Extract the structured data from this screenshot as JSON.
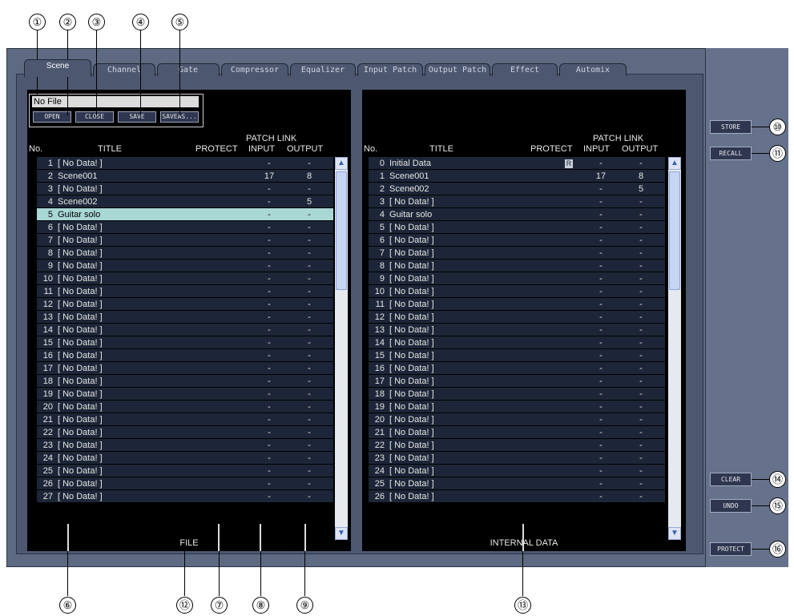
{
  "tabs": [
    "Scene",
    "Channel",
    "Gate",
    "Compressor",
    "Equalizer",
    "Input Patch",
    "Output Patch",
    "Effect",
    "Automix"
  ],
  "file": {
    "name": "No File",
    "buttons": {
      "open": "OPEN",
      "close": "CLOSE",
      "save": "SAVE",
      "saveas": "SAVEAS..."
    }
  },
  "columns": {
    "no": "No.",
    "title": "TITLE",
    "protect": "PROTECT",
    "patch_link": "PATCH LINK",
    "input": "INPUT",
    "output": "OUTPUT"
  },
  "left_panel": {
    "footer": "FILE",
    "rows": [
      {
        "no": "1",
        "title": "[  No Data!  ]",
        "protect": "",
        "input": "-",
        "output": "-"
      },
      {
        "no": "2",
        "title": "Scene001",
        "protect": "",
        "input": "17",
        "output": "8"
      },
      {
        "no": "3",
        "title": "[  No Data!  ]",
        "protect": "",
        "input": "-",
        "output": "-"
      },
      {
        "no": "4",
        "title": "Scene002",
        "protect": "",
        "input": "-",
        "output": "5"
      },
      {
        "no": "5",
        "title": "Guitar solo",
        "protect": "",
        "input": "-",
        "output": "-",
        "selected": true
      },
      {
        "no": "6",
        "title": "[  No Data!  ]",
        "protect": "",
        "input": "-",
        "output": "-"
      },
      {
        "no": "7",
        "title": "[  No Data!  ]",
        "protect": "",
        "input": "-",
        "output": "-"
      },
      {
        "no": "8",
        "title": "[  No Data!  ]",
        "protect": "",
        "input": "-",
        "output": "-"
      },
      {
        "no": "9",
        "title": "[  No Data!  ]",
        "protect": "",
        "input": "-",
        "output": "-"
      },
      {
        "no": "10",
        "title": "[  No Data!  ]",
        "protect": "",
        "input": "-",
        "output": "-"
      },
      {
        "no": "11",
        "title": "[  No Data!  ]",
        "protect": "",
        "input": "-",
        "output": "-"
      },
      {
        "no": "12",
        "title": "[  No Data!  ]",
        "protect": "",
        "input": "-",
        "output": "-"
      },
      {
        "no": "13",
        "title": "[  No Data!  ]",
        "protect": "",
        "input": "-",
        "output": "-"
      },
      {
        "no": "14",
        "title": "[  No Data!  ]",
        "protect": "",
        "input": "-",
        "output": "-"
      },
      {
        "no": "15",
        "title": "[  No Data!  ]",
        "protect": "",
        "input": "-",
        "output": "-"
      },
      {
        "no": "16",
        "title": "[  No Data!  ]",
        "protect": "",
        "input": "-",
        "output": "-"
      },
      {
        "no": "17",
        "title": "[  No Data!  ]",
        "protect": "",
        "input": "-",
        "output": "-"
      },
      {
        "no": "18",
        "title": "[  No Data!  ]",
        "protect": "",
        "input": "-",
        "output": "-"
      },
      {
        "no": "19",
        "title": "[  No Data!  ]",
        "protect": "",
        "input": "-",
        "output": "-"
      },
      {
        "no": "20",
        "title": "[  No Data!  ]",
        "protect": "",
        "input": "-",
        "output": "-"
      },
      {
        "no": "21",
        "title": "[  No Data!  ]",
        "protect": "",
        "input": "-",
        "output": "-"
      },
      {
        "no": "22",
        "title": "[  No Data!  ]",
        "protect": "",
        "input": "-",
        "output": "-"
      },
      {
        "no": "23",
        "title": "[  No Data!  ]",
        "protect": "",
        "input": "-",
        "output": "-"
      },
      {
        "no": "24",
        "title": "[  No Data!  ]",
        "protect": "",
        "input": "-",
        "output": "-"
      },
      {
        "no": "25",
        "title": "[  No Data!  ]",
        "protect": "",
        "input": "-",
        "output": "-"
      },
      {
        "no": "26",
        "title": "[  No Data!  ]",
        "protect": "",
        "input": "-",
        "output": "-"
      },
      {
        "no": "27",
        "title": "[  No Data!  ]",
        "protect": "",
        "input": "-",
        "output": "-"
      }
    ]
  },
  "right_panel": {
    "footer": "INTERNAL DATA",
    "rows": [
      {
        "no": "0",
        "title": "Initial Data",
        "protect": "R",
        "input": "-",
        "output": "-"
      },
      {
        "no": "1",
        "title": "Scene001",
        "protect": "",
        "input": "17",
        "output": "8"
      },
      {
        "no": "2",
        "title": "Scene002",
        "protect": "",
        "input": "-",
        "output": "5"
      },
      {
        "no": "3",
        "title": "[  No Data!  ]",
        "protect": "",
        "input": "-",
        "output": "-"
      },
      {
        "no": "4",
        "title": "Guitar solo",
        "protect": "",
        "input": "-",
        "output": "-"
      },
      {
        "no": "5",
        "title": "[  No Data!  ]",
        "protect": "",
        "input": "-",
        "output": "-"
      },
      {
        "no": "6",
        "title": "[  No Data!  ]",
        "protect": "",
        "input": "-",
        "output": "-"
      },
      {
        "no": "7",
        "title": "[  No Data!  ]",
        "protect": "",
        "input": "-",
        "output": "-"
      },
      {
        "no": "8",
        "title": "[  No Data!  ]",
        "protect": "",
        "input": "-",
        "output": "-"
      },
      {
        "no": "9",
        "title": "[  No Data!  ]",
        "protect": "",
        "input": "-",
        "output": "-"
      },
      {
        "no": "10",
        "title": "[  No Data!  ]",
        "protect": "",
        "input": "-",
        "output": "-"
      },
      {
        "no": "11",
        "title": "[  No Data!  ]",
        "protect": "",
        "input": "-",
        "output": "-"
      },
      {
        "no": "12",
        "title": "[  No Data!  ]",
        "protect": "",
        "input": "-",
        "output": "-"
      },
      {
        "no": "13",
        "title": "[  No Data!  ]",
        "protect": "",
        "input": "-",
        "output": "-"
      },
      {
        "no": "14",
        "title": "[  No Data!  ]",
        "protect": "",
        "input": "-",
        "output": "-"
      },
      {
        "no": "15",
        "title": "[  No Data!  ]",
        "protect": "",
        "input": "-",
        "output": "-"
      },
      {
        "no": "16",
        "title": "[  No Data!  ]",
        "protect": "",
        "input": "-",
        "output": "-"
      },
      {
        "no": "17",
        "title": "[  No Data!  ]",
        "protect": "",
        "input": "-",
        "output": "-"
      },
      {
        "no": "18",
        "title": "[  No Data!  ]",
        "protect": "",
        "input": "-",
        "output": "-"
      },
      {
        "no": "19",
        "title": "[  No Data!  ]",
        "protect": "",
        "input": "-",
        "output": "-"
      },
      {
        "no": "20",
        "title": "[  No Data!  ]",
        "protect": "",
        "input": "-",
        "output": "-"
      },
      {
        "no": "21",
        "title": "[  No Data!  ]",
        "protect": "",
        "input": "-",
        "output": "-"
      },
      {
        "no": "22",
        "title": "[  No Data!  ]",
        "protect": "",
        "input": "-",
        "output": "-"
      },
      {
        "no": "23",
        "title": "[  No Data!  ]",
        "protect": "",
        "input": "-",
        "output": "-"
      },
      {
        "no": "24",
        "title": "[  No Data!  ]",
        "protect": "",
        "input": "-",
        "output": "-"
      },
      {
        "no": "25",
        "title": "[  No Data!  ]",
        "protect": "",
        "input": "-",
        "output": "-"
      },
      {
        "no": "26",
        "title": "[  No Data!  ]",
        "protect": "",
        "input": "-",
        "output": "-"
      }
    ]
  },
  "side_buttons": {
    "store": "STORE",
    "recall": "RECALL",
    "clear": "CLEAR",
    "undo": "UNDO",
    "protect": "PROTECT"
  },
  "callouts": [
    "①",
    "②",
    "③",
    "④",
    "⑤",
    "⑥",
    "⑦",
    "⑧",
    "⑨",
    "⑩",
    "⑪",
    "⑫",
    "⑬",
    "⑭",
    "⑮",
    "⑯"
  ],
  "colors": {
    "selected_row": "#a9d7d6",
    "row_bg": "#1d2638",
    "panel_bg": "#000000",
    "frame": "#5d6a82"
  }
}
